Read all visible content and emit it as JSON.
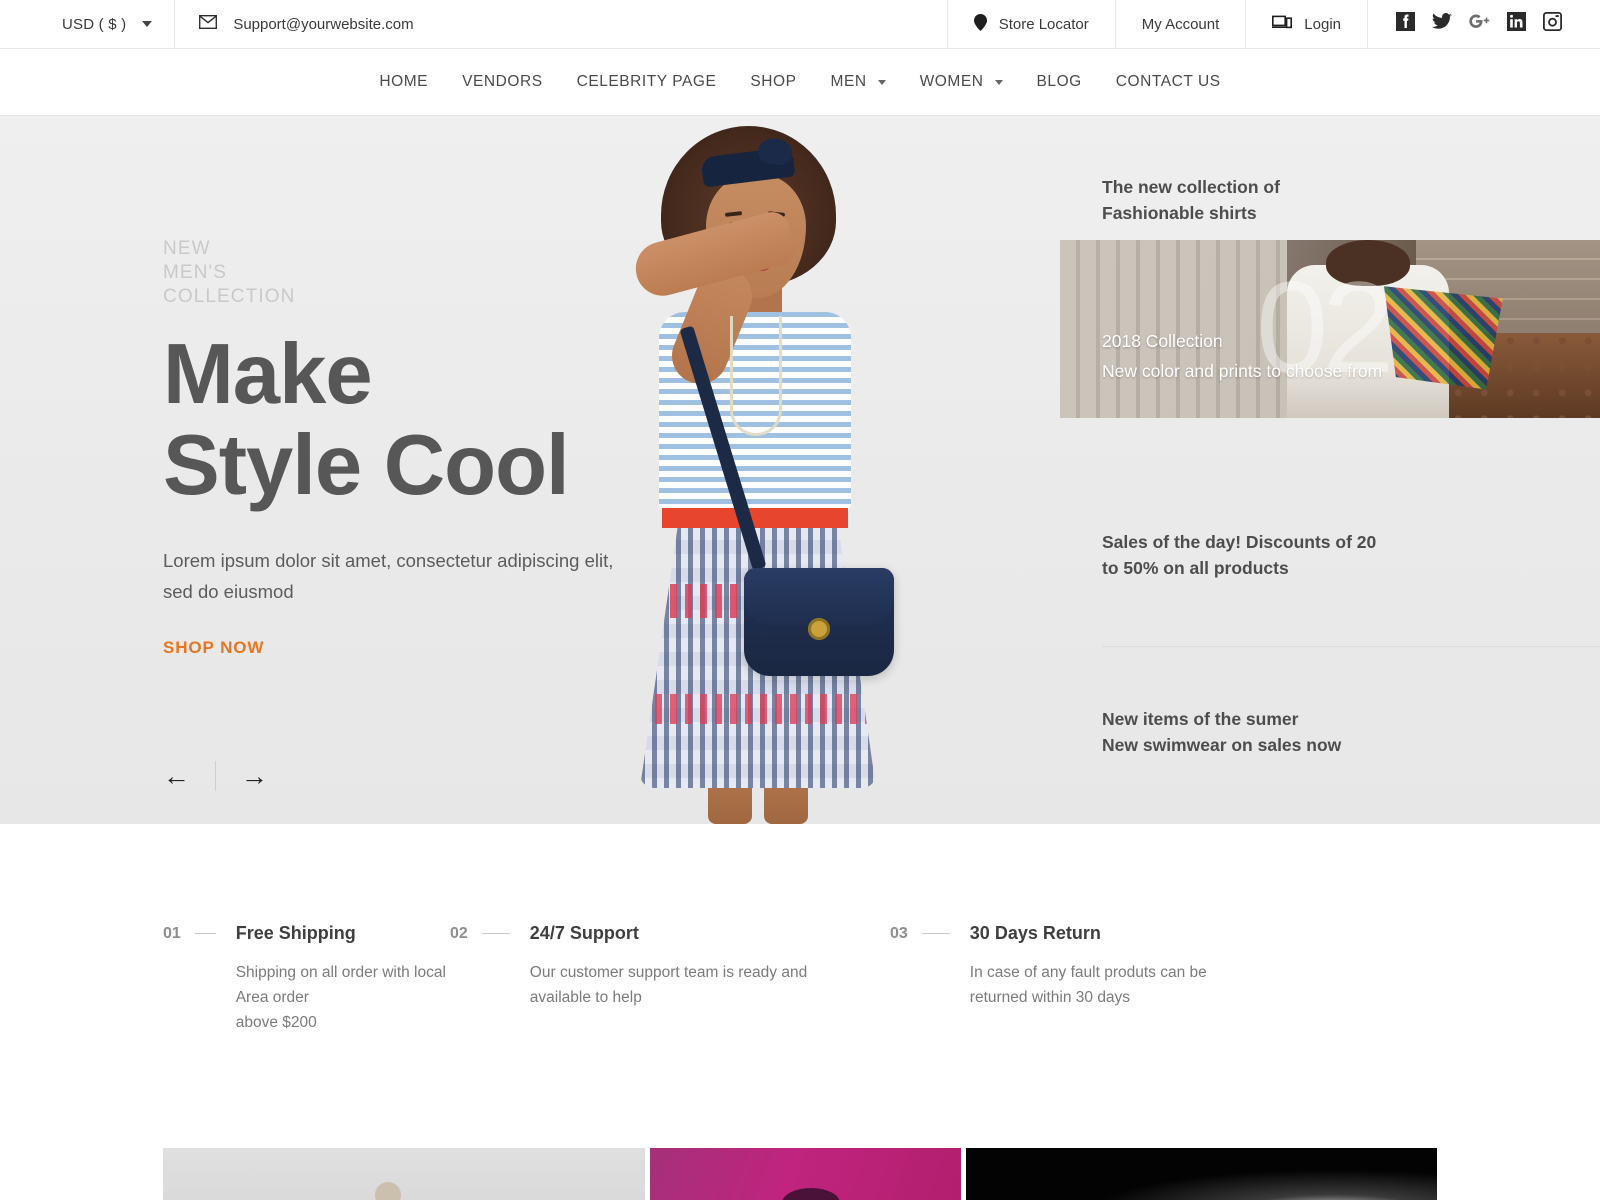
{
  "topbar": {
    "currency": "USD ( $ )",
    "email": "Support@yourwebsite.com",
    "store_locator": "Store Locator",
    "my_account": "My Account",
    "login": "Login",
    "social": [
      "facebook-icon",
      "twitter-icon",
      "google-plus-icon",
      "linkedin-icon",
      "instagram-icon"
    ]
  },
  "nav": {
    "items": [
      {
        "label": "HOME",
        "has_dropdown": false
      },
      {
        "label": "VENDORS",
        "has_dropdown": false
      },
      {
        "label": "CELEBRITY PAGE",
        "has_dropdown": false
      },
      {
        "label": "SHOP",
        "has_dropdown": false
      },
      {
        "label": "MEN",
        "has_dropdown": true
      },
      {
        "label": "WOMEN",
        "has_dropdown": true
      },
      {
        "label": "BLOG",
        "has_dropdown": false
      },
      {
        "label": "CONTACT US",
        "has_dropdown": false
      }
    ]
  },
  "hero": {
    "eyebrow_line1": "NEW",
    "eyebrow_line2": "MEN'S",
    "eyebrow_line3": "COLLECTION",
    "title_line1": "Make",
    "title_line2": "Style Cool",
    "subtitle_line1": "Lorem ipsum dolor sit amet, consectetur adipiscing elit,",
    "subtitle_line2": "sed do eiusmod",
    "cta": "SHOP NOW",
    "cta_color": "#e8761f",
    "prev_arrow": "←",
    "next_arrow": "→",
    "background_color": "#ececec"
  },
  "hero_sidebar": {
    "promo_top_line1": "The new collection of",
    "promo_top_line2": "Fashionable shirts",
    "card": {
      "watermark": "02",
      "line1": "2018 Collection",
      "line2": "New color and prints to choose from"
    },
    "promo_mid_line1": "Sales of the day! Discounts of 20",
    "promo_mid_line2": "to 50% on all products",
    "promo_bot_line1": "New items of the sumer",
    "promo_bot_line2": "New swimwear on sales now"
  },
  "features": [
    {
      "number": "01",
      "title": "Free Shipping",
      "desc_line1": "Shipping on all order with local Area order",
      "desc_line2": "above $200"
    },
    {
      "number": "02",
      "title": "24/7 Support",
      "desc_line1": "Our customer support team is ready and",
      "desc_line2": "available to help"
    },
    {
      "number": "03",
      "title": "30 Days Return",
      "desc_line1": "In case of any fault produts can be",
      "desc_line2": "returned within 30 days"
    }
  ],
  "cards": [
    {
      "name": "promo-card-light",
      "color": "#dedede"
    },
    {
      "name": "promo-card-magenta",
      "color": "#b8257a"
    },
    {
      "name": "promo-card-dark",
      "color": "#030303"
    }
  ]
}
